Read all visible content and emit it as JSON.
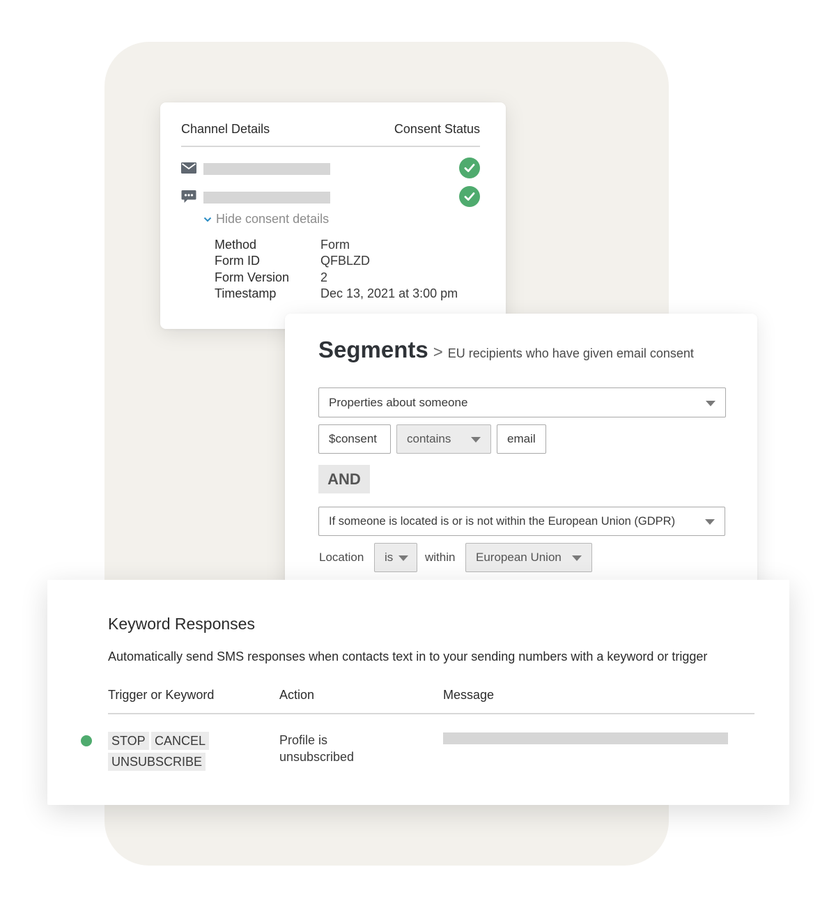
{
  "channel": {
    "header_left": "Channel Details",
    "header_right": "Consent Status",
    "rows": [
      {
        "icon": "envelope-icon",
        "status": "consented"
      },
      {
        "icon": "chat-bubble-icon",
        "status": "consented"
      }
    ],
    "hide_link": "Hide consent details",
    "details": [
      {
        "label": "Method",
        "value": "Form"
      },
      {
        "label": "Form ID",
        "value": "QFBLZD"
      },
      {
        "label": "Form Version",
        "value": "2"
      },
      {
        "label": "Timestamp",
        "value": "Dec 13, 2021 at 3:00 pm"
      }
    ]
  },
  "segments": {
    "title": "Segments",
    "separator": ">",
    "subtitle": "EU recipients who have given email consent",
    "condition1": {
      "dropdown": "Properties about someone",
      "property": "$consent",
      "operator": "contains",
      "value": "email"
    },
    "and_label": "AND",
    "condition2": {
      "dropdown": "If someone is located is or is not within the European Union (GDPR)",
      "location_label": "Location",
      "is_value": "is",
      "within_label": "within",
      "region": "European Union"
    }
  },
  "keyword": {
    "title": "Keyword Responses",
    "description": "Automatically send SMS responses when contacts text in to your sending numbers with a keyword or trigger",
    "columns": [
      "Trigger or Keyword",
      "Action",
      "Message"
    ],
    "row": {
      "keywords": [
        "STOP",
        "CANCEL",
        "UNSUBSCRIBE"
      ],
      "action": "Profile is unsubscribed",
      "status": "active"
    }
  },
  "colors": {
    "backdrop": "#f3f1ec",
    "success_green": "#4fab6e",
    "link_blue": "#2a8cc4"
  }
}
